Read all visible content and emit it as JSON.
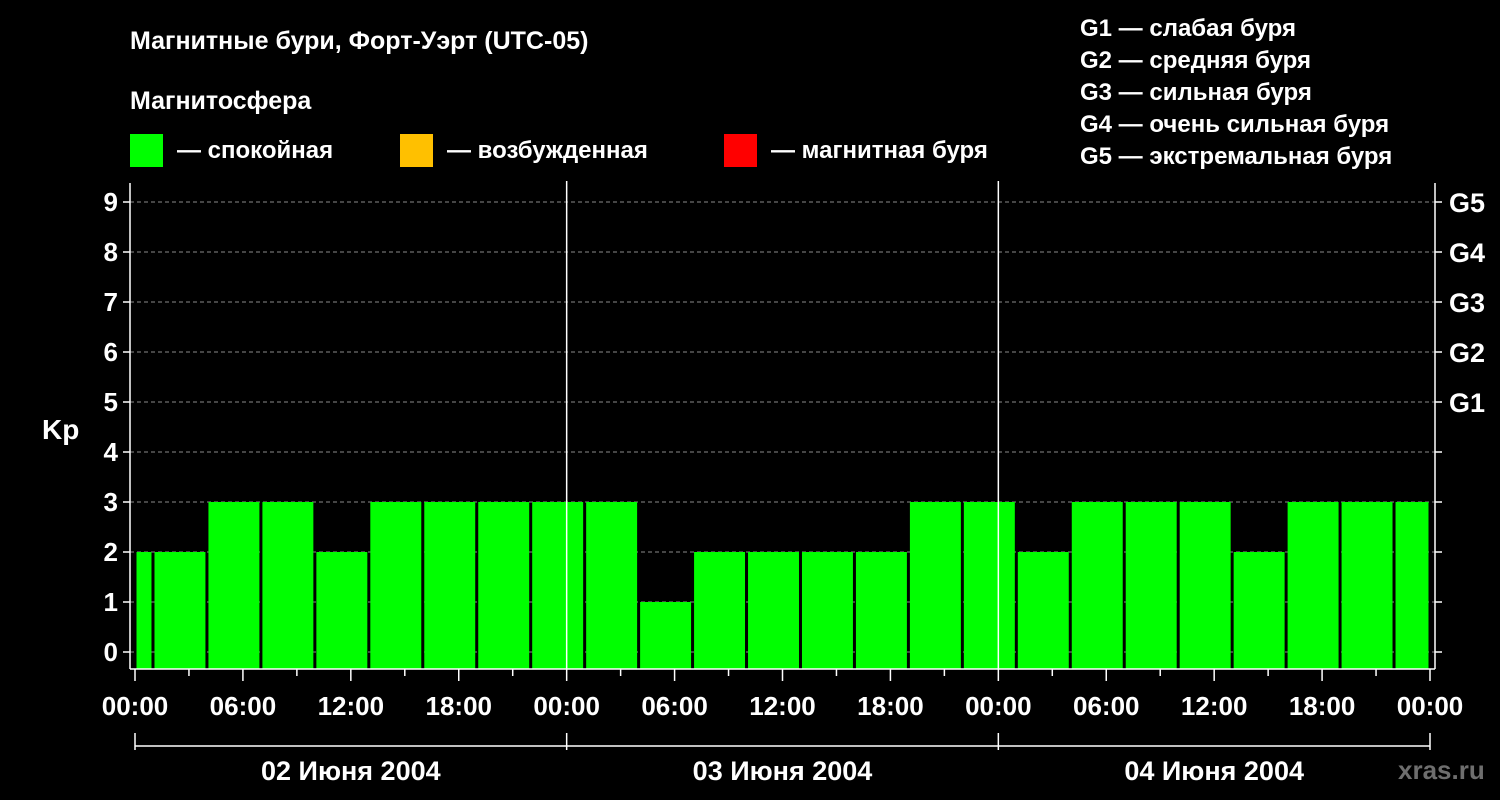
{
  "header": {
    "title": "Магнитные бури, Форт-Уэрт (UTC-05)",
    "legend_title": "Магнитосфера",
    "legend": [
      {
        "label": "— спокойная",
        "color": "#00ff00"
      },
      {
        "label": "— возбужденная",
        "color": "#ffc000"
      },
      {
        "label": "— магнитная буря",
        "color": "#ff0000"
      }
    ],
    "storm_scale": [
      "G1 — слабая буря",
      "G2 — средняя буря",
      "G3 — сильная буря",
      "G4 — очень сильная буря",
      "G5 — экстремальная буря"
    ]
  },
  "watermark": "xras.ru",
  "chart_data": {
    "type": "bar",
    "ylabel": "Kp",
    "ylim": [
      0,
      9
    ],
    "y_ticks": [
      "0",
      "1",
      "2",
      "3",
      "4",
      "5",
      "6",
      "7",
      "8",
      "9"
    ],
    "g_levels": [
      {
        "label": "G1",
        "kp": 5
      },
      {
        "label": "G2",
        "kp": 6
      },
      {
        "label": "G3",
        "kp": 7
      },
      {
        "label": "G4",
        "kp": 8
      },
      {
        "label": "G5",
        "kp": 9
      }
    ],
    "x_ticks": [
      "00:00",
      "06:00",
      "12:00",
      "18:00",
      "00:00",
      "06:00",
      "12:00",
      "18:00",
      "00:00",
      "06:00",
      "12:00",
      "18:00",
      "00:00"
    ],
    "days": [
      "02 Июня 2004",
      "03 Июня 2004",
      "04 Июня 2004"
    ],
    "grid": true,
    "bar_color": "#00ff00",
    "bars": [
      {
        "start_h": 0,
        "end_h": 1,
        "kp": 2
      },
      {
        "start_h": 1,
        "end_h": 4,
        "kp": 2
      },
      {
        "start_h": 4,
        "end_h": 7,
        "kp": 3
      },
      {
        "start_h": 7,
        "end_h": 10,
        "kp": 3
      },
      {
        "start_h": 10,
        "end_h": 13,
        "kp": 2
      },
      {
        "start_h": 13,
        "end_h": 16,
        "kp": 3
      },
      {
        "start_h": 16,
        "end_h": 19,
        "kp": 3
      },
      {
        "start_h": 19,
        "end_h": 22,
        "kp": 3
      },
      {
        "start_h": 22,
        "end_h": 25,
        "kp": 3
      },
      {
        "start_h": 25,
        "end_h": 28,
        "kp": 3
      },
      {
        "start_h": 28,
        "end_h": 31,
        "kp": 1
      },
      {
        "start_h": 31,
        "end_h": 34,
        "kp": 2
      },
      {
        "start_h": 34,
        "end_h": 37,
        "kp": 2
      },
      {
        "start_h": 37,
        "end_h": 40,
        "kp": 2
      },
      {
        "start_h": 40,
        "end_h": 43,
        "kp": 2
      },
      {
        "start_h": 43,
        "end_h": 46,
        "kp": 3
      },
      {
        "start_h": 46,
        "end_h": 49,
        "kp": 3
      },
      {
        "start_h": 49,
        "end_h": 52,
        "kp": 2
      },
      {
        "start_h": 52,
        "end_h": 55,
        "kp": 3
      },
      {
        "start_h": 55,
        "end_h": 58,
        "kp": 3
      },
      {
        "start_h": 58,
        "end_h": 61,
        "kp": 3
      },
      {
        "start_h": 61,
        "end_h": 64,
        "kp": 2
      },
      {
        "start_h": 64,
        "end_h": 67,
        "kp": 3
      },
      {
        "start_h": 67,
        "end_h": 70,
        "kp": 3
      },
      {
        "start_h": 70,
        "end_h": 72,
        "kp": 3
      }
    ]
  }
}
